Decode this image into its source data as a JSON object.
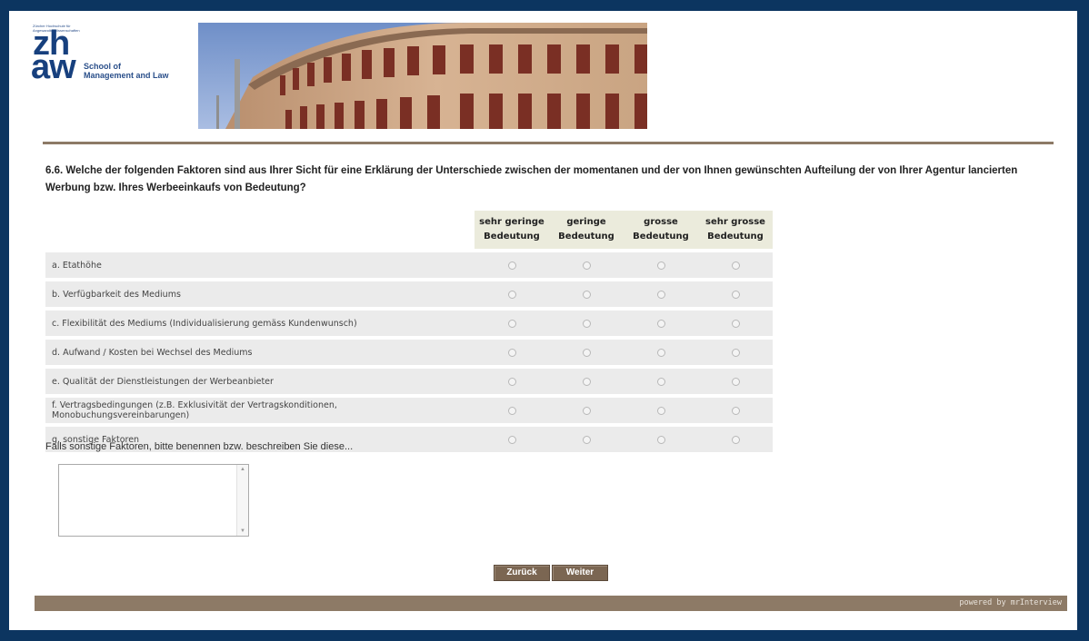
{
  "header": {
    "logo_small_text": "Zürcher Hochschule für Angewandte Wissenschaften",
    "logo_zh": "zh",
    "logo_aw": "aw",
    "logo_school_line1": "School of",
    "logo_school_line2": "Management and Law"
  },
  "question": {
    "text": "6.6. Welche der folgenden Faktoren sind aus Ihrer Sicht für eine Erklärung der Unterschiede zwischen der momentanen und der von Ihnen gewünschten Aufteilung der von Ihrer Agentur lancierten Werbung bzw. Ihres Werbeeinkaufs von Bedeutung?"
  },
  "grid": {
    "columns": [
      {
        "line1": "sehr geringe",
        "line2": "Bedeutung"
      },
      {
        "line1": "geringe",
        "line2": "Bedeutung"
      },
      {
        "line1": "grosse",
        "line2": "Bedeutung"
      },
      {
        "line1": "sehr grosse",
        "line2": "Bedeutung"
      }
    ],
    "rows": [
      "a. Etathöhe",
      "b. Verfügbarkeit des Mediums",
      "c. Flexibilität des Mediums (Individualisierung gemäss Kundenwunsch)",
      "d. Aufwand / Kosten bei Wechsel des Mediums",
      "e. Qualität der Dienstleistungen der Werbeanbieter",
      "f. Vertragsbedingungen (z.B. Exklusivität der Vertragskonditionen, Monobuchungsvereinbarungen)",
      "g. sonstige Faktoren"
    ]
  },
  "other": {
    "label": "Falls sonstige Faktoren, bitte benennen bzw. beschreiben Sie diese...",
    "value": ""
  },
  "buttons": {
    "back": "Zurück",
    "next": "Weiter"
  },
  "footer": {
    "powered": "powered by mrInterview"
  },
  "colors": {
    "page_background": "#0c3560",
    "accent_brown": "#8d7a66",
    "button_brown": "#7b6652",
    "logo_blue": "#17407e"
  }
}
